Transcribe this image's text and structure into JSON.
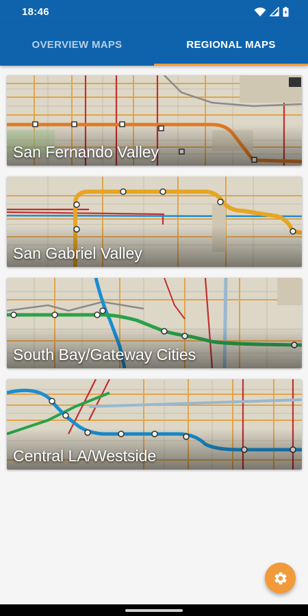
{
  "status_bar": {
    "time": "18:46",
    "icons": [
      "wifi-icon",
      "signal-icon",
      "battery-icon"
    ]
  },
  "tabs": [
    {
      "label": "OVERVIEW MAPS",
      "selected": false
    },
    {
      "label": "REGIONAL MAPS",
      "selected": true
    }
  ],
  "regions": [
    {
      "title": "San Fernando Valley"
    },
    {
      "title": "San Gabriel Valley"
    },
    {
      "title": "South Bay/Gateway Cities"
    },
    {
      "title": "Central LA/Westside"
    }
  ],
  "fab": {
    "icon": "gear-icon"
  },
  "colors": {
    "app_bar": "#0f63ad",
    "tab_indicator": "#f19a3a",
    "fab": "#f19a3a",
    "map_background": "#ddd7c8",
    "metro_orange_line": "#e07b24",
    "metro_gold_line": "#e6a524",
    "metro_blue_line": "#1a8ed1",
    "metro_green_line": "#2aa14a",
    "metro_red_line": "#d6263a"
  }
}
